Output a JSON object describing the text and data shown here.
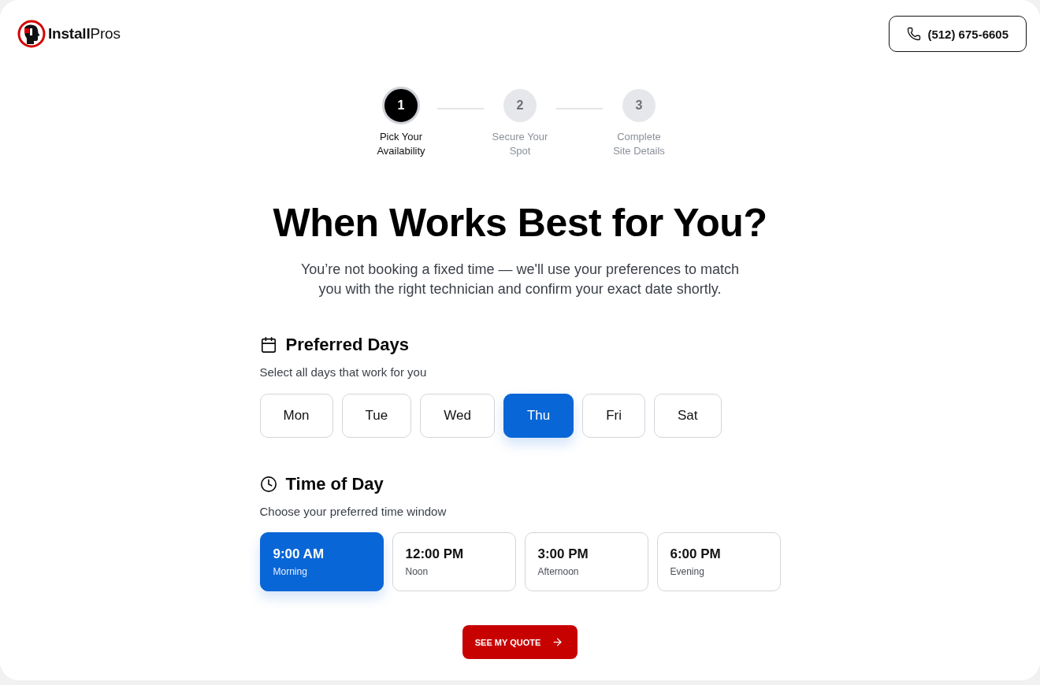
{
  "header": {
    "logo": "**Install**Pros",
    "phone": "(512) 675-6605"
  },
  "steps": [
    {
      "number": "1",
      "label": "Pick Your Availability",
      "active": true
    },
    {
      "number": "2",
      "label": "Secure Your Spot",
      "active": false
    },
    {
      "number": "3",
      "label": "Complete Site Details",
      "active": false
    }
  ],
  "title": "When Works Best for You?",
  "subtitle": "You’re not booking a fixed time — we'll use your preferences to match you with the right technician and confirm your exact date shortly.",
  "days_section": {
    "heading": "Preferred Days",
    "hint": "Select all days that work for you",
    "days": [
      {
        "label": "Mon",
        "selected": false
      },
      {
        "label": "Tue",
        "selected": false
      },
      {
        "label": "Wed",
        "selected": false
      },
      {
        "label": "Thu",
        "selected": true
      },
      {
        "label": "Fri",
        "selected": false
      },
      {
        "label": "Sat",
        "selected": false
      }
    ]
  },
  "time_section": {
    "heading": "Time of Day",
    "hint": "Choose your preferred time window",
    "slots": [
      {
        "time": "9:00 AM",
        "period": "Morning",
        "selected": true
      },
      {
        "time": "12:00 PM",
        "period": "Noon",
        "selected": false
      },
      {
        "time": "3:00 PM",
        "period": "Afternoon",
        "selected": false
      },
      {
        "time": "6:00 PM",
        "period": "Evening",
        "selected": false
      }
    ]
  },
  "submit": "SEE MY QUOTE"
}
